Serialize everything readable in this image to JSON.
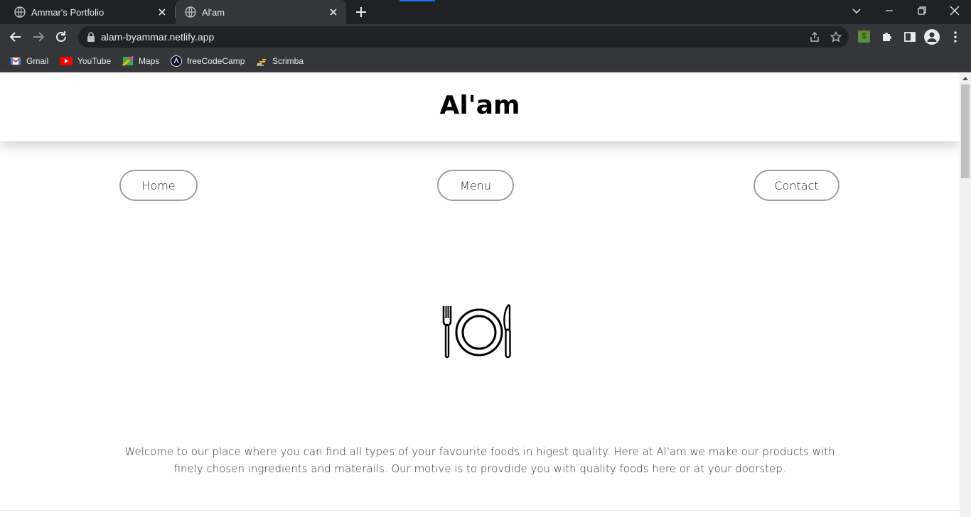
{
  "browser": {
    "tabs": [
      {
        "title": "Ammar's Portfolio",
        "active": false
      },
      {
        "title": "Al'am",
        "active": true
      }
    ],
    "url": "alam-byammar.netlify.app",
    "bookmarks": [
      "Gmail",
      "YouTube",
      "Maps",
      "freeCodeCamp",
      "Scrimba"
    ],
    "extension_badge": "$"
  },
  "site": {
    "title": "Al'am",
    "nav": {
      "home": "Home",
      "menu": "Menu",
      "contact": "Contact"
    },
    "hero_icon": "fork-plate-knife-icon",
    "welcome_text": "Welcome to our place where you can find all types of your favourite foods in higest quality. Here at Al'am we make our products with finely chosen ingredients and materails. Our motive is to provdide you with quality foods here or at your doorstep."
  },
  "colors": {
    "chrome_dark": "#202124",
    "chrome_toolbar": "#35363a",
    "pill_border": "#9e9e9e",
    "ext_green": "#5a8f3a"
  }
}
